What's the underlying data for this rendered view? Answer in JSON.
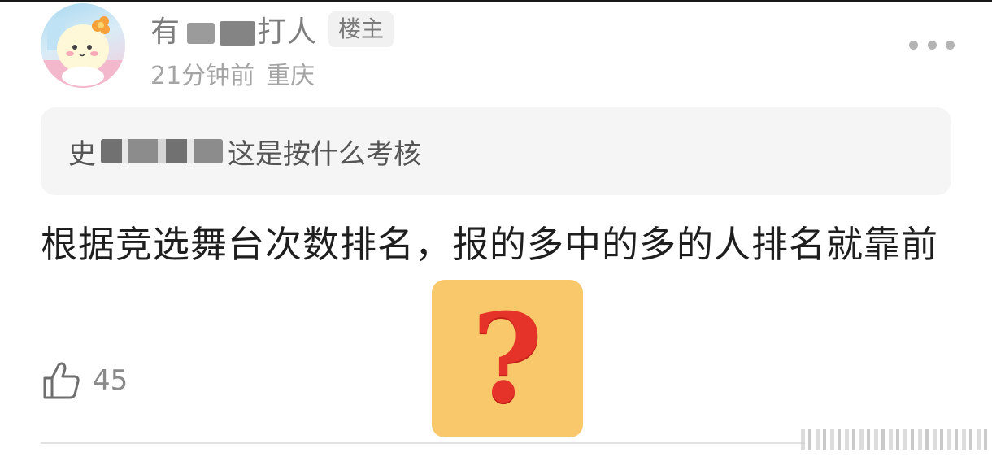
{
  "post": {
    "author": {
      "name_prefix": "有",
      "name_suffix": "打人",
      "op_badge": "楼主",
      "time": "21分钟前",
      "location": "重庆"
    },
    "quote": {
      "author_prefix": "史",
      "text": "这是按什么考核"
    },
    "reply_text": "根据竞选舞台次数排名，报的多中的多的人排名就靠前",
    "emoji": "question-mark",
    "like_count": "45"
  },
  "icons": {
    "more": "more-dots-icon",
    "like": "thumbs-up-icon"
  },
  "colors": {
    "emoji_bg": "#f9c86a",
    "emoji_fg": "#e5332a",
    "quote_bg": "#f5f5f5",
    "meta": "#a4a4a4"
  }
}
